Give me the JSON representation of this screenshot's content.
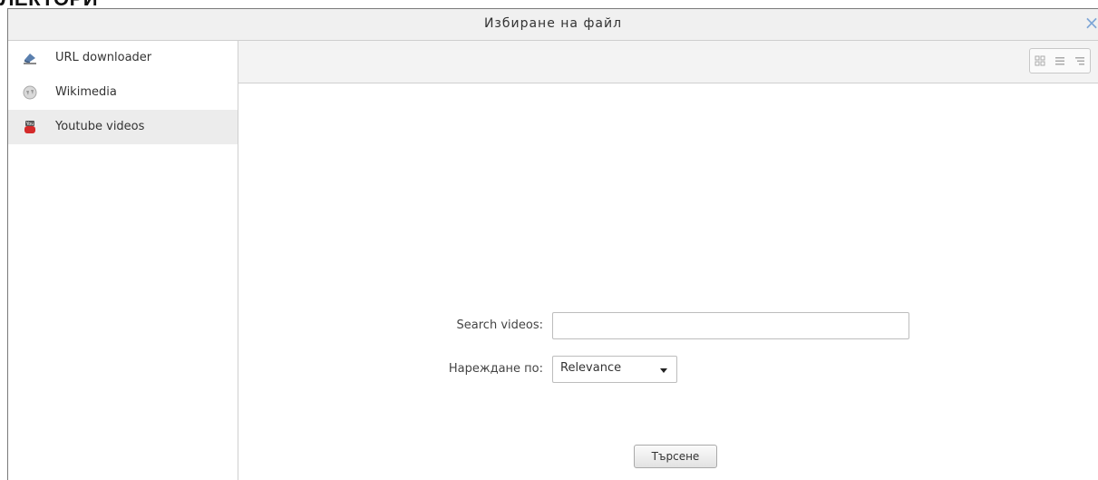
{
  "page_header": {
    "text": "ЛЕКТОРИ"
  },
  "dialog": {
    "title": "Избиране на файл",
    "close_symbol": "×"
  },
  "sidebar": {
    "items": [
      {
        "label": "URL downloader",
        "icon": "url-downloader-icon",
        "active": false
      },
      {
        "label": "Wikimedia",
        "icon": "wikimedia-icon",
        "active": false
      },
      {
        "label": "Youtube videos",
        "icon": "youtube-icon",
        "active": true
      }
    ]
  },
  "toolbar": {
    "view_buttons": [
      "icons-view-icon",
      "list-view-icon",
      "tree-view-icon"
    ]
  },
  "form": {
    "search_label": "Search videos:",
    "search_value": "",
    "sort_label": "Нареждане по:",
    "sort_value": "Relevance",
    "submit_label": "Търсене"
  },
  "colors": {
    "close_icon": "#7fa6d6",
    "active_item_bg": "#ececec",
    "toolbar_bg": "#f3f3f3"
  }
}
